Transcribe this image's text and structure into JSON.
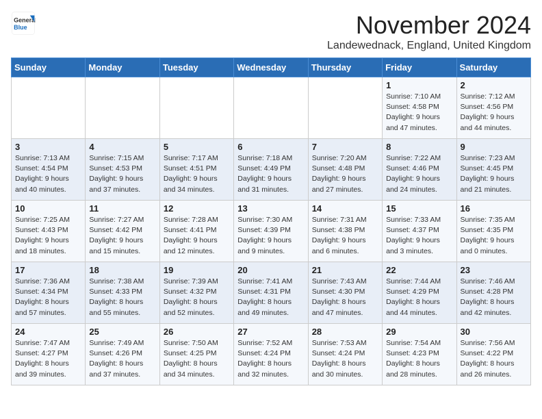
{
  "logo": {
    "general": "General",
    "blue": "Blue"
  },
  "title": "November 2024",
  "location": "Landewednack, England, United Kingdom",
  "days_of_week": [
    "Sunday",
    "Monday",
    "Tuesday",
    "Wednesday",
    "Thursday",
    "Friday",
    "Saturday"
  ],
  "weeks": [
    [
      {
        "day": "",
        "info": ""
      },
      {
        "day": "",
        "info": ""
      },
      {
        "day": "",
        "info": ""
      },
      {
        "day": "",
        "info": ""
      },
      {
        "day": "",
        "info": ""
      },
      {
        "day": "1",
        "info": "Sunrise: 7:10 AM\nSunset: 4:58 PM\nDaylight: 9 hours and 47 minutes."
      },
      {
        "day": "2",
        "info": "Sunrise: 7:12 AM\nSunset: 4:56 PM\nDaylight: 9 hours and 44 minutes."
      }
    ],
    [
      {
        "day": "3",
        "info": "Sunrise: 7:13 AM\nSunset: 4:54 PM\nDaylight: 9 hours and 40 minutes."
      },
      {
        "day": "4",
        "info": "Sunrise: 7:15 AM\nSunset: 4:53 PM\nDaylight: 9 hours and 37 minutes."
      },
      {
        "day": "5",
        "info": "Sunrise: 7:17 AM\nSunset: 4:51 PM\nDaylight: 9 hours and 34 minutes."
      },
      {
        "day": "6",
        "info": "Sunrise: 7:18 AM\nSunset: 4:49 PM\nDaylight: 9 hours and 31 minutes."
      },
      {
        "day": "7",
        "info": "Sunrise: 7:20 AM\nSunset: 4:48 PM\nDaylight: 9 hours and 27 minutes."
      },
      {
        "day": "8",
        "info": "Sunrise: 7:22 AM\nSunset: 4:46 PM\nDaylight: 9 hours and 24 minutes."
      },
      {
        "day": "9",
        "info": "Sunrise: 7:23 AM\nSunset: 4:45 PM\nDaylight: 9 hours and 21 minutes."
      }
    ],
    [
      {
        "day": "10",
        "info": "Sunrise: 7:25 AM\nSunset: 4:43 PM\nDaylight: 9 hours and 18 minutes."
      },
      {
        "day": "11",
        "info": "Sunrise: 7:27 AM\nSunset: 4:42 PM\nDaylight: 9 hours and 15 minutes."
      },
      {
        "day": "12",
        "info": "Sunrise: 7:28 AM\nSunset: 4:41 PM\nDaylight: 9 hours and 12 minutes."
      },
      {
        "day": "13",
        "info": "Sunrise: 7:30 AM\nSunset: 4:39 PM\nDaylight: 9 hours and 9 minutes."
      },
      {
        "day": "14",
        "info": "Sunrise: 7:31 AM\nSunset: 4:38 PM\nDaylight: 9 hours and 6 minutes."
      },
      {
        "day": "15",
        "info": "Sunrise: 7:33 AM\nSunset: 4:37 PM\nDaylight: 9 hours and 3 minutes."
      },
      {
        "day": "16",
        "info": "Sunrise: 7:35 AM\nSunset: 4:35 PM\nDaylight: 9 hours and 0 minutes."
      }
    ],
    [
      {
        "day": "17",
        "info": "Sunrise: 7:36 AM\nSunset: 4:34 PM\nDaylight: 8 hours and 57 minutes."
      },
      {
        "day": "18",
        "info": "Sunrise: 7:38 AM\nSunset: 4:33 PM\nDaylight: 8 hours and 55 minutes."
      },
      {
        "day": "19",
        "info": "Sunrise: 7:39 AM\nSunset: 4:32 PM\nDaylight: 8 hours and 52 minutes."
      },
      {
        "day": "20",
        "info": "Sunrise: 7:41 AM\nSunset: 4:31 PM\nDaylight: 8 hours and 49 minutes."
      },
      {
        "day": "21",
        "info": "Sunrise: 7:43 AM\nSunset: 4:30 PM\nDaylight: 8 hours and 47 minutes."
      },
      {
        "day": "22",
        "info": "Sunrise: 7:44 AM\nSunset: 4:29 PM\nDaylight: 8 hours and 44 minutes."
      },
      {
        "day": "23",
        "info": "Sunrise: 7:46 AM\nSunset: 4:28 PM\nDaylight: 8 hours and 42 minutes."
      }
    ],
    [
      {
        "day": "24",
        "info": "Sunrise: 7:47 AM\nSunset: 4:27 PM\nDaylight: 8 hours and 39 minutes."
      },
      {
        "day": "25",
        "info": "Sunrise: 7:49 AM\nSunset: 4:26 PM\nDaylight: 8 hours and 37 minutes."
      },
      {
        "day": "26",
        "info": "Sunrise: 7:50 AM\nSunset: 4:25 PM\nDaylight: 8 hours and 34 minutes."
      },
      {
        "day": "27",
        "info": "Sunrise: 7:52 AM\nSunset: 4:24 PM\nDaylight: 8 hours and 32 minutes."
      },
      {
        "day": "28",
        "info": "Sunrise: 7:53 AM\nSunset: 4:24 PM\nDaylight: 8 hours and 30 minutes."
      },
      {
        "day": "29",
        "info": "Sunrise: 7:54 AM\nSunset: 4:23 PM\nDaylight: 8 hours and 28 minutes."
      },
      {
        "day": "30",
        "info": "Sunrise: 7:56 AM\nSunset: 4:22 PM\nDaylight: 8 hours and 26 minutes."
      }
    ]
  ]
}
